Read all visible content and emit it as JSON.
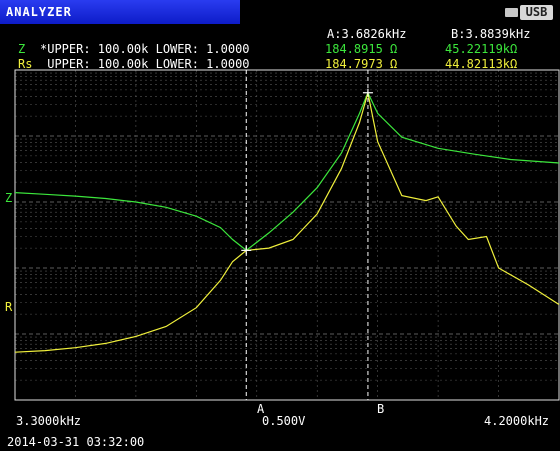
{
  "header": {
    "title": "ANALYZER",
    "usb_label": "USB",
    "cursor_a_freq": "A:3.6826kHz",
    "cursor_b_freq": "B:3.8839kHz"
  },
  "channels": [
    {
      "name": "Z",
      "scale": "*UPPER: 100.00k LOWER: 1.0000",
      "value_a": "184.8915 Ω",
      "value_b": "45.22119kΩ",
      "color": "#3ce63c",
      "axis_marker": "Z"
    },
    {
      "name": "Rs",
      "scale": " UPPER: 100.00k LOWER: 1.0000",
      "value_a": "184.7973 Ω",
      "value_b": "44.82113kΩ",
      "color": "#f0f03c",
      "axis_marker": "R"
    }
  ],
  "footer": {
    "x_start": "3.3000kHz",
    "x_end": "4.2000kHz",
    "cursor_a_label": "A",
    "cursor_b_label": "B",
    "center_value": "0.500V",
    "datetime": "2014-03-31 03:32:00"
  },
  "chart_data": {
    "type": "line",
    "xlim": [
      3.3,
      4.2
    ],
    "x_unit": "kHz",
    "y_scale": "log",
    "ylim": [
      1,
      100000
    ],
    "grid": true,
    "cursors": [
      3.6826,
      3.8839
    ],
    "series": [
      {
        "name": "Z",
        "color": "#3ce63c",
        "x": [
          3.3,
          3.35,
          3.4,
          3.45,
          3.5,
          3.55,
          3.6,
          3.64,
          3.66,
          3.6826,
          3.72,
          3.76,
          3.8,
          3.84,
          3.87,
          3.8839,
          3.9,
          3.94,
          4.0,
          4.06,
          4.12,
          4.2
        ],
        "y": [
          1390,
          1310,
          1230,
          1130,
          1000,
          830,
          610,
          410,
          270,
          185,
          340,
          700,
          1650,
          5500,
          22000,
          45221,
          22000,
          9600,
          6500,
          5300,
          4400,
          3900
        ]
      },
      {
        "name": "Rs",
        "color": "#f0f03c",
        "x": [
          3.3,
          3.35,
          3.4,
          3.45,
          3.5,
          3.55,
          3.6,
          3.64,
          3.66,
          3.6826,
          3.72,
          3.76,
          3.8,
          3.84,
          3.87,
          3.8839,
          3.9,
          3.94,
          3.98,
          4.0,
          4.03,
          4.05,
          4.08,
          4.1,
          4.15,
          4.2
        ],
        "y": [
          5.3,
          5.6,
          6.2,
          7.2,
          9.2,
          13,
          25,
          65,
          125,
          185,
          200,
          270,
          660,
          3200,
          16000,
          44821,
          8200,
          1250,
          1050,
          1200,
          430,
          270,
          300,
          100,
          55,
          28
        ]
      }
    ]
  }
}
